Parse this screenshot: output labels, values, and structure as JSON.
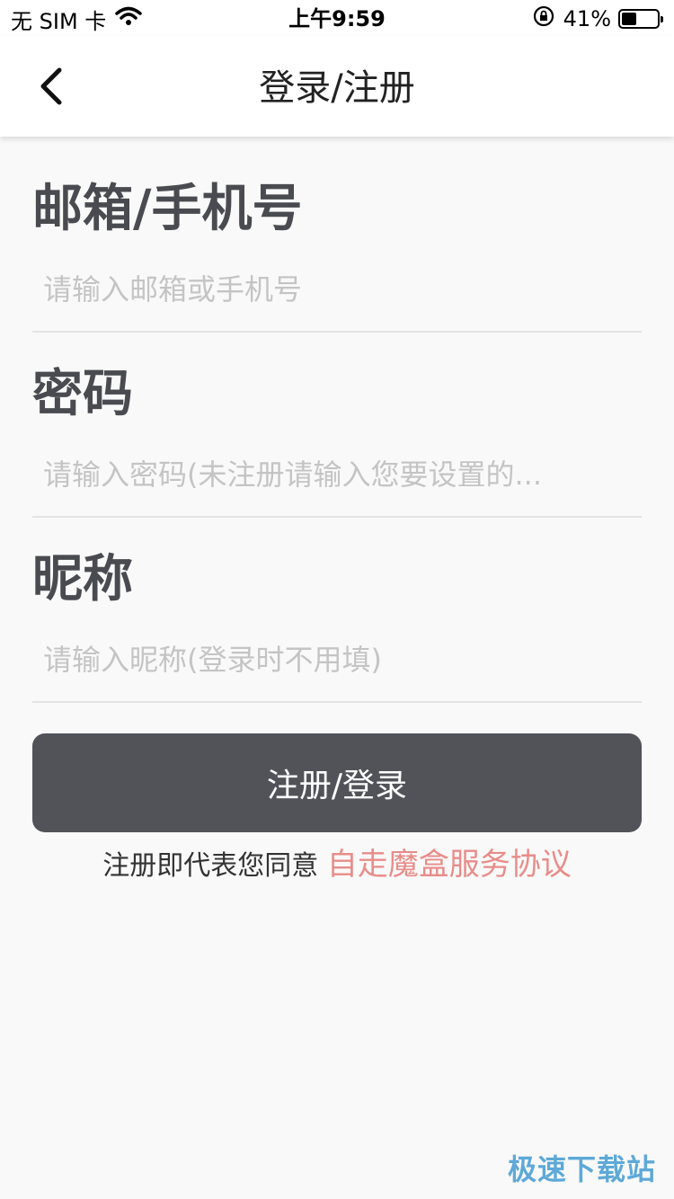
{
  "status_bar": {
    "carrier": "无 SIM 卡",
    "time": "上午9:59",
    "battery_percent": "41%",
    "battery_level": 0.41
  },
  "nav": {
    "title": "登录/注册"
  },
  "form": {
    "account": {
      "label": "邮箱/手机号",
      "placeholder": "请输入邮箱或手机号",
      "value": ""
    },
    "password": {
      "label": "密码",
      "placeholder": "请输入密码(未注册请输入您要设置的...",
      "value": ""
    },
    "nickname": {
      "label": "昵称",
      "placeholder": "请输入昵称(登录时不用填)",
      "value": ""
    },
    "submit_label": "注册/登录"
  },
  "agreement": {
    "prefix": "注册即代表您同意",
    "link": "自走魔盒服务协议"
  },
  "watermark": "极速下载站",
  "colors": {
    "button": "#525359",
    "link": "#e88d8a",
    "label": "#4a4b50",
    "placeholder": "#c4c4c4"
  }
}
